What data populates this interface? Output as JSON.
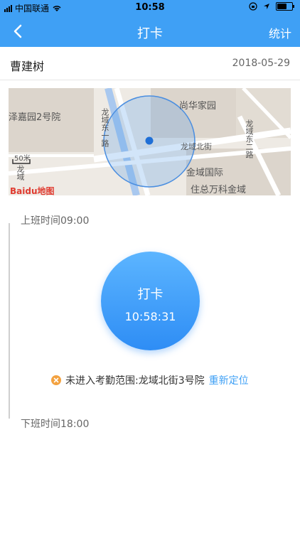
{
  "status_bar": {
    "carrier": "中国联通",
    "time": "10:58"
  },
  "nav": {
    "title": "打卡",
    "right_action": "统计"
  },
  "header": {
    "name": "曹建树",
    "date": "2018-05-29"
  },
  "map": {
    "labels": [
      "尚华家园",
      "龙域东一路",
      "龙域东二路",
      "龙域北街",
      "金域国际",
      "住总万科金域",
      "泽嘉园2号院",
      "龙域",
      "50米"
    ],
    "logo": "Baidu地图"
  },
  "timeline": {
    "checkin_label": "上班时间09:00",
    "checkout_label": "下班时间18:00"
  },
  "punch": {
    "label": "打卡",
    "time": "10:58:31"
  },
  "notice": {
    "text": "未进入考勤范围:龙域北街3号院",
    "action": "重新定位"
  },
  "colors": {
    "primary": "#3fa0f5",
    "warning": "#f3a240"
  }
}
